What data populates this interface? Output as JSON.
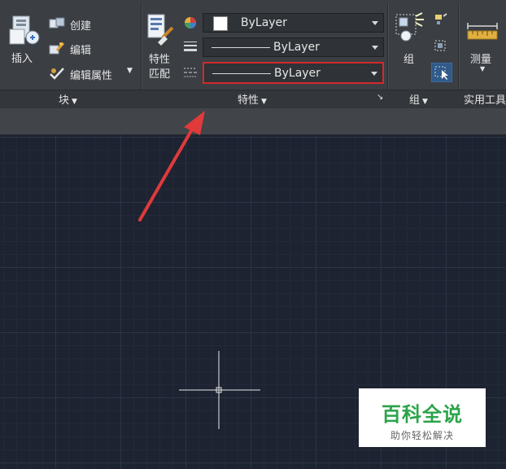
{
  "ribbon": {
    "block_panel": {
      "insert_label": "插入",
      "create_label": "创建",
      "edit_label": "编辑",
      "edit_attributes_label": "编辑属性",
      "panel_title": "块"
    },
    "properties_panel": {
      "match_properties_label_line1": "特性",
      "match_properties_label_line2": "匹配",
      "color_value": "ByLayer",
      "lineweight_value": "ByLayer",
      "linetype_value": "ByLayer",
      "panel_title": "特性"
    },
    "group_panel": {
      "group_label": "组",
      "panel_title": "组"
    },
    "utilities_panel": {
      "measure_label": "测量",
      "panel_title": "实用工具"
    }
  },
  "watermark": {
    "title": "百科全说",
    "subtitle": "助你轻松解决"
  },
  "colors": {
    "highlight": "#d32a2a",
    "annotation_arrow": "#e03a3a",
    "watermark_green": "#2aa44a"
  }
}
